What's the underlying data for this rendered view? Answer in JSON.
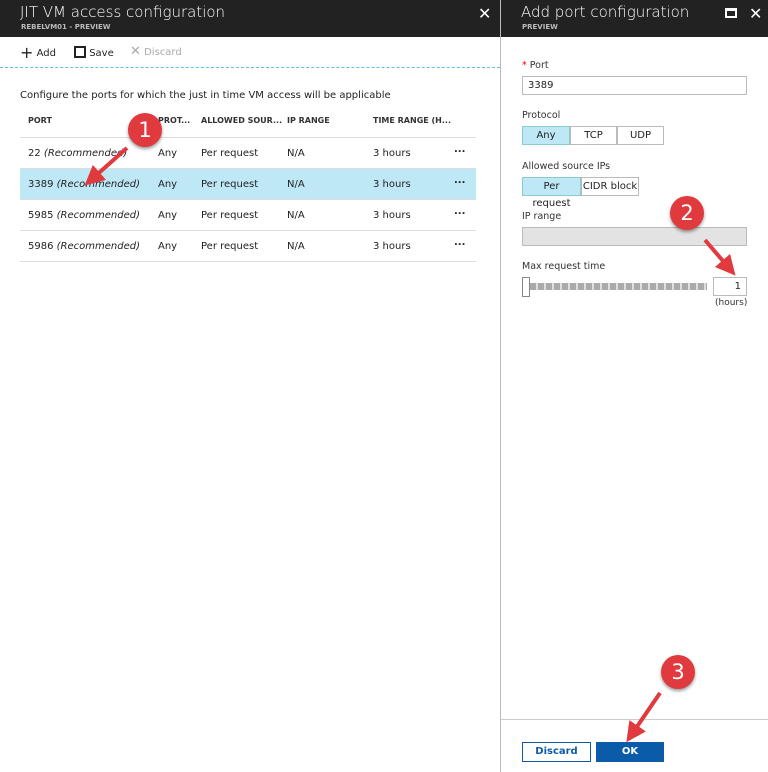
{
  "left": {
    "title": "JIT VM access configuration",
    "subtitle": "REBELVM01 - PREVIEW",
    "close": "✕",
    "toolbar": {
      "add": "Add",
      "save": "Save",
      "discard": "Discard"
    },
    "description": "Configure the ports for which the just in time VM access will be applicable",
    "columns": [
      "PORT",
      "PROT...",
      "ALLOWED SOUR...",
      "IP RANGE",
      "TIME RANGE (H..."
    ],
    "rows": [
      {
        "port": "22",
        "note": "(Recommended)",
        "protocol": "Any",
        "source": "Per request",
        "ip": "N/A",
        "time": "3 hours",
        "more": "..."
      },
      {
        "port": "3389",
        "note": "(Recommended)",
        "protocol": "Any",
        "source": "Per request",
        "ip": "N/A",
        "time": "3 hours",
        "more": "...",
        "selected": true
      },
      {
        "port": "5985",
        "note": "(Recommended)",
        "protocol": "Any",
        "source": "Per request",
        "ip": "N/A",
        "time": "3 hours",
        "more": "..."
      },
      {
        "port": "5986",
        "note": "(Recommended)",
        "protocol": "Any",
        "source": "Per request",
        "ip": "N/A",
        "time": "3 hours",
        "more": "..."
      }
    ]
  },
  "right": {
    "title": "Add port configuration",
    "subtitle": "PREVIEW",
    "close": "✕",
    "port_label": "Port",
    "required_mark": "*",
    "port_value": "3389",
    "protocol_label": "Protocol",
    "protocol_options": [
      "Any",
      "TCP",
      "UDP"
    ],
    "protocol_selected": "Any",
    "source_label": "Allowed source IPs",
    "source_options": [
      "Per request",
      "CIDR block"
    ],
    "source_selected": "Per request",
    "ip_label": "IP range",
    "ip_value": "",
    "max_label": "Max request time",
    "max_value": "1",
    "max_unit": "(hours)",
    "discard": "Discard",
    "ok": "OK"
  },
  "annotations": [
    "1",
    "2",
    "3"
  ],
  "colors": {
    "header": "#222222",
    "selected": "#bfe8f6",
    "primary": "#0a5ca8",
    "annotation": "#e0393e"
  }
}
